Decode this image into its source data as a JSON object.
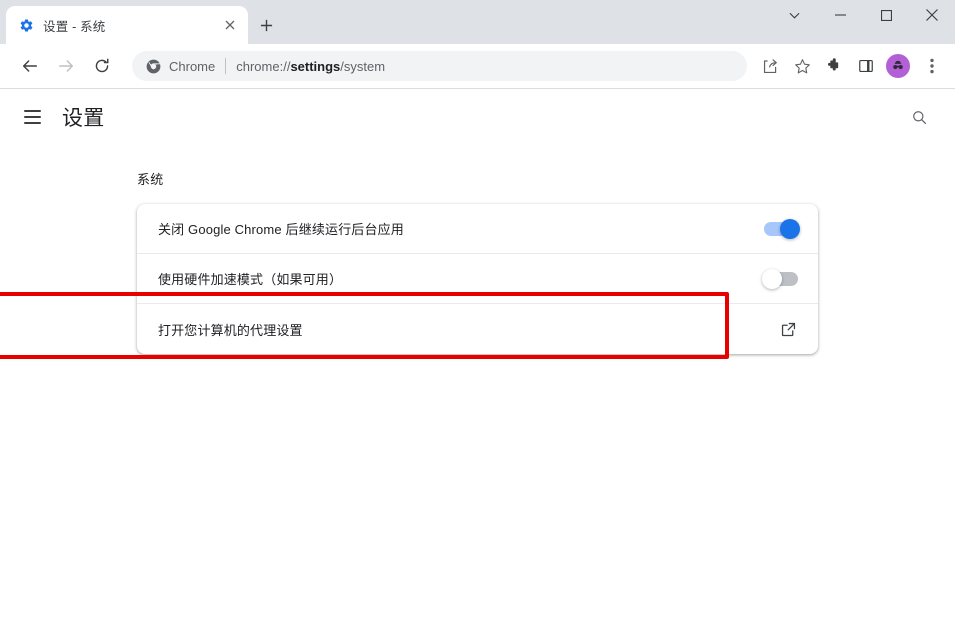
{
  "window": {
    "tab": {
      "title": "设置 - 系统",
      "favicon": "settings-gear-icon",
      "close_label": "×"
    },
    "new_tab_label": "+",
    "controls": {
      "tab_search": "tab-search-chevron-icon",
      "minimize": "minimize-icon",
      "maximize": "maximize-icon",
      "close": "close-icon"
    }
  },
  "toolbar": {
    "back": "back-arrow-icon",
    "forward": "forward-arrow-icon",
    "reload": "reload-icon",
    "omnibox": {
      "chrome_label": "Chrome",
      "url_prefix": "chrome://",
      "url_emphasis": "settings",
      "url_suffix": "/system"
    },
    "share": "share-icon",
    "bookmark": "bookmark-star-icon",
    "extensions": "extensions-puzzle-icon",
    "side_panel": "side-panel-icon",
    "profile": "profile-avatar-icon",
    "menu": "three-dot-menu-icon"
  },
  "settings_header": {
    "menu": "hamburger-menu-icon",
    "title": "设置",
    "search": "search-icon"
  },
  "main": {
    "section_title": "系统",
    "rows": [
      {
        "label": "关闭 Google Chrome 后继续运行后台应用",
        "control": "toggle",
        "state": "on"
      },
      {
        "label": "使用硬件加速模式（如果可用）",
        "control": "toggle",
        "state": "off"
      },
      {
        "label": "打开您计算机的代理设置",
        "control": "external-link",
        "state": ""
      }
    ]
  },
  "annotation": {
    "target": "打开您计算机的代理设置",
    "color": "#e60000"
  },
  "colors": {
    "accent": "#1a73e8",
    "toggle_off": "#bdc1c6",
    "tabstrip": "#dee1e6",
    "omnibox": "#f1f3f4",
    "avatar": "#b35fd6",
    "highlight": "#e60000"
  }
}
